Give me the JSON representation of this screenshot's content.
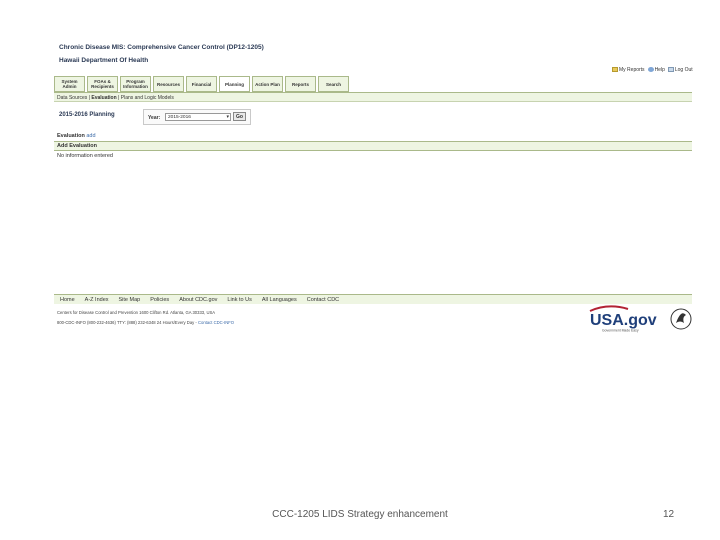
{
  "header": {
    "title": "Chronic Disease MIS: Comprehensive Cancer Control (DP12-1205)",
    "org": "Hawaii Department Of Health"
  },
  "top_links": [
    "My Reports",
    "Help",
    "Log Out"
  ],
  "tabs": [
    {
      "label": "System Admin"
    },
    {
      "label": "FOAs & Recipients"
    },
    {
      "label": "Program Information"
    },
    {
      "label": "Resources"
    },
    {
      "label": "Financial"
    },
    {
      "label": "Planning"
    },
    {
      "label": "Action Plan"
    },
    {
      "label": "Reports"
    },
    {
      "label": "Search"
    }
  ],
  "subnav": {
    "item1": "Data Sources",
    "item2": "Evaluation",
    "item3": "Plans and Logic Models"
  },
  "planning": {
    "heading": "2015-2016 Planning",
    "year_label": "Year:",
    "year_value": "2015-2016",
    "go_label": "Go"
  },
  "evaluation": {
    "label": "Evaluation",
    "add_link": "add",
    "add_header": "Add Evaluation",
    "empty": "No information entered"
  },
  "footer": {
    "links": [
      "Home",
      "A-Z Index",
      "Site Map",
      "Policies",
      "About CDC.gov",
      "Link to Us",
      "All Languages",
      "Contact CDC"
    ],
    "address": "Centers for Disease Control and Prevention   1600 Clifton Rd. Atlanta, GA 30333, USA",
    "phone": "800-CDC-INFO (800-232-4636) TTY: (888) 232-6348  24 Hours/Every Day -",
    "contact_link": "Contact CDC-INFO"
  },
  "logos": {
    "usagov": "USA.gov",
    "usagov_tagline": "Government Made Easy"
  },
  "slide": {
    "caption": "CCC-1205 LIDS Strategy enhancement",
    "page": "12"
  },
  "colors": {
    "tab_bg": "#eef5e2",
    "tab_border": "#aab98a",
    "title_color": "#2b3a55",
    "link": "#3b6aa8"
  }
}
